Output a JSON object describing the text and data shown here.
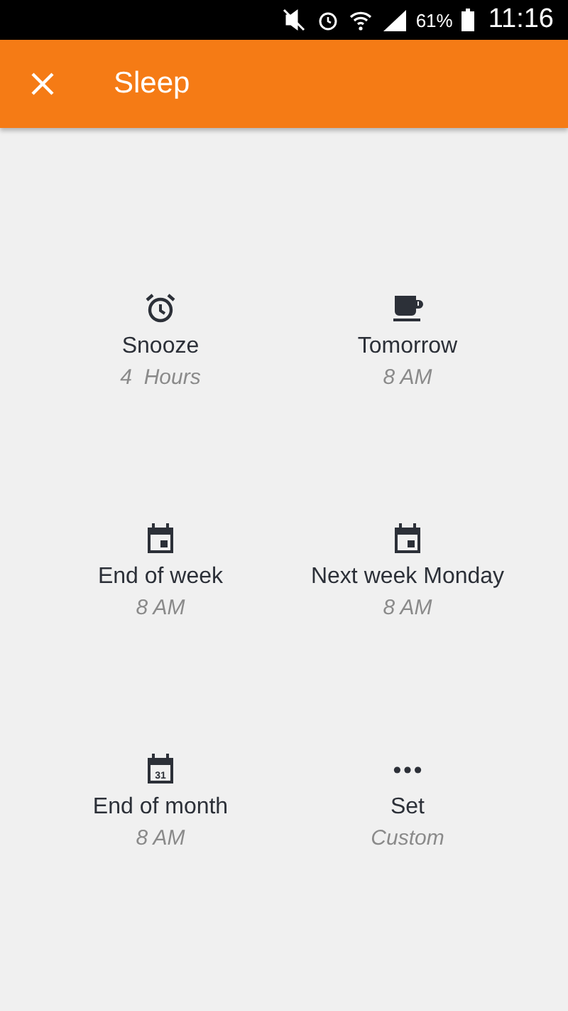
{
  "status_bar": {
    "battery": "61%",
    "time": "11:16"
  },
  "app_bar": {
    "title": "Sleep"
  },
  "options": [
    {
      "kind": "alarm",
      "label": "Snooze",
      "detail": "4  Hours"
    },
    {
      "kind": "cup",
      "label": "Tomorrow",
      "detail": "8 AM"
    },
    {
      "kind": "calendar",
      "label": "End of week",
      "detail": "8 AM"
    },
    {
      "kind": "calendar",
      "label": "Next week Monday",
      "detail": "8 AM"
    },
    {
      "kind": "calendar-day",
      "icon_text": "31",
      "label": "End of month",
      "detail": "8 AM"
    },
    {
      "kind": "dots",
      "label": "Set",
      "detail": "Custom"
    }
  ]
}
